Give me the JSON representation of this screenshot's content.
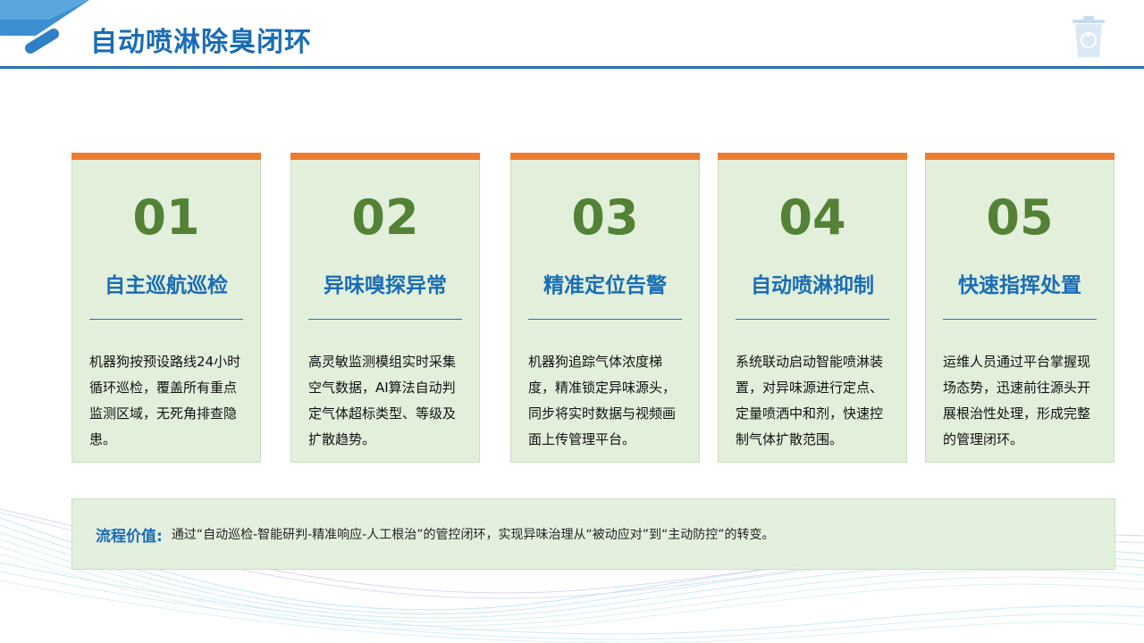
{
  "header": {
    "title": "自动喷淋除臭闭环",
    "corner_decoration_icon": "diagonal-stripes-icon",
    "bin_icon": "recycle-bin-icon"
  },
  "colors": {
    "title_blue": "#1a6db5",
    "card_bg": "#e2efdb",
    "card_topbar": "#ed7d31",
    "number_green": "#538135",
    "rule_blue": "#2a73b8"
  },
  "cards": [
    {
      "number": "01",
      "title": "自主巡航巡检",
      "description": "机器狗按预设路线24小时循环巡检，覆盖所有重点监测区域，无死角排查隐患。"
    },
    {
      "number": "02",
      "title": "异味嗅探异常",
      "description": "高灵敏监测模组实时采集空气数据，AI算法自动判定气体超标类型、等级及扩散趋势。"
    },
    {
      "number": "03",
      "title": "精准定位告警",
      "description": "机器狗追踪气体浓度梯度，精准锁定异味源头，同步将实时数据与视频画面上传管理平台。"
    },
    {
      "number": "04",
      "title": "自动喷淋抑制",
      "description": "系统联动启动智能喷淋装置，对异味源进行定点、定量喷洒中和剂，快速控制气体扩散范围。"
    },
    {
      "number": "05",
      "title": "快速指挥处置",
      "description": "运维人员通过平台掌握现场态势，迅速前往源头开展根治性处理，形成完整的管理闭环。"
    }
  ],
  "summary": {
    "label": "流程价值:",
    "text": "通过“自动巡检-智能研判-精准响应-人工根治”的管控闭环，实现异味治理从“被动应对”到“主动防控”的转变。"
  }
}
